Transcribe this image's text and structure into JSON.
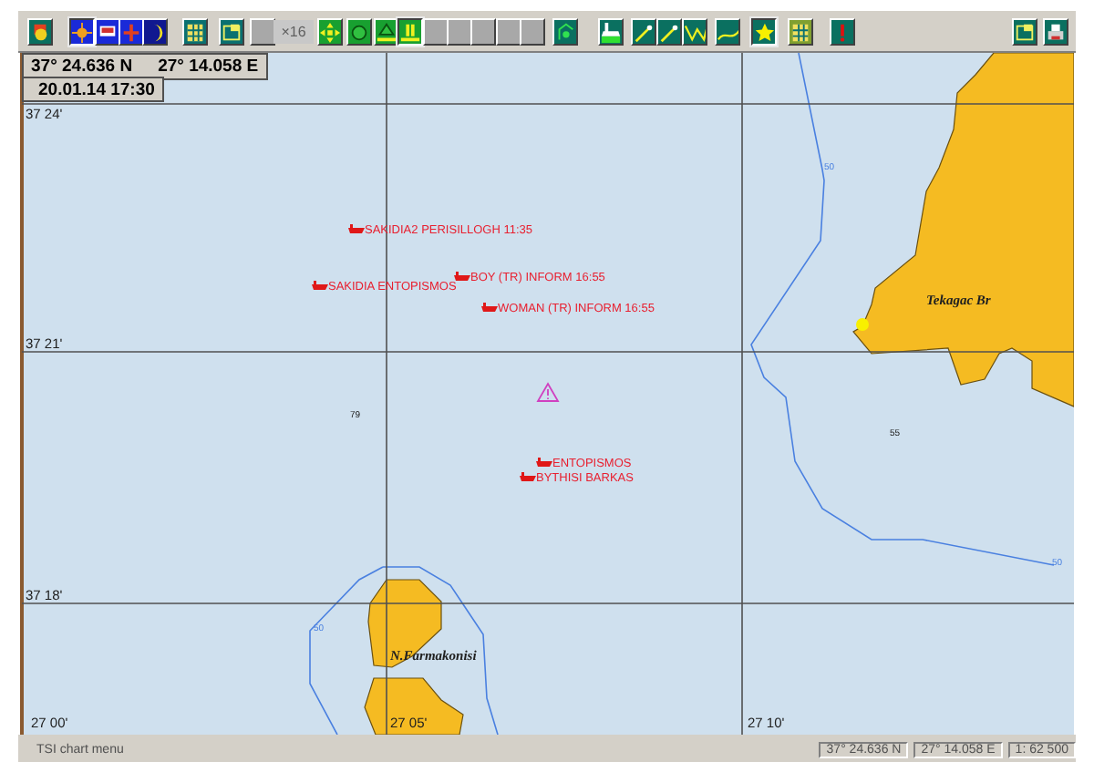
{
  "toolbar": {
    "buttons": [
      {
        "kind": "tool",
        "selected": false
      },
      {
        "kind": "tool",
        "selected": true
      },
      {
        "kind": "tool",
        "selected": false
      },
      {
        "kind": "tool",
        "selected": false
      },
      {
        "kind": "tool",
        "selected": false
      },
      {
        "kind": "tool",
        "selected": false
      },
      {
        "kind": "tool",
        "selected": false
      },
      {
        "kind": "empty",
        "selected": false
      },
      {
        "kind": "zoom",
        "label": "×16",
        "selected": false
      },
      {
        "kind": "tool",
        "selected": false
      },
      {
        "kind": "tool",
        "selected": false
      },
      {
        "kind": "tool",
        "selected": false
      },
      {
        "kind": "tool",
        "selected": true
      },
      {
        "kind": "empty",
        "selected": false
      },
      {
        "kind": "empty",
        "selected": false
      },
      {
        "kind": "empty",
        "selected": false
      },
      {
        "kind": "empty",
        "selected": false
      },
      {
        "kind": "empty",
        "selected": false
      },
      {
        "kind": "tool",
        "selected": false
      },
      {
        "kind": "tool",
        "selected": false
      },
      {
        "kind": "tool",
        "selected": false
      },
      {
        "kind": "tool",
        "selected": false
      },
      {
        "kind": "tool",
        "selected": false
      },
      {
        "kind": "tool",
        "selected": false
      },
      {
        "kind": "tool",
        "selected": true
      },
      {
        "kind": "tool",
        "selected": false
      },
      {
        "kind": "tool",
        "selected": false
      }
    ],
    "right_buttons": [
      {
        "kind": "tool",
        "selected": false
      },
      {
        "kind": "tool",
        "selected": false
      }
    ]
  },
  "position": {
    "latitude": "37° 24.636 N",
    "longitude": "27° 14.058 E",
    "datetime": "20.01.14  17:30"
  },
  "chart": {
    "latitude_labels": [
      "37 24'",
      "37 21'",
      "37 18'"
    ],
    "longitude_labels": [
      "27 00'",
      "27 05'",
      "27 10'"
    ],
    "targets": [
      {
        "label": "SAKIDIA2 PERISILLOGH 11:35"
      },
      {
        "label": "BOY (TR) INFORM 16:55"
      },
      {
        "label": "SAKIDIA ENTOPISMOS"
      },
      {
        "label": "WOMAN (TR) INFORM 16:55"
      },
      {
        "label": "ENTOPISMOS"
      },
      {
        "label": "BYTHISI BARKAS"
      }
    ],
    "place_names": [
      "Tekagac Br",
      "N.Farmakonisi"
    ],
    "soundings": [
      "79",
      "55"
    ],
    "contour_labels": [
      "50",
      "50",
      "50"
    ]
  },
  "status_bar": {
    "message": "TSI chart menu",
    "latitude": "37° 24.636 N",
    "longitude": "27° 14.058 E",
    "scale": "1: 62 500"
  }
}
